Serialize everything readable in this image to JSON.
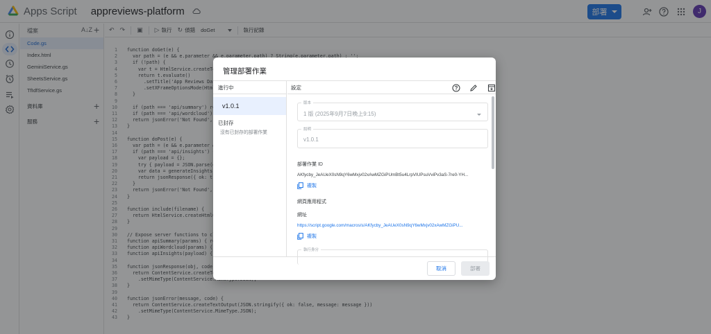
{
  "header": {
    "app_name": "Apps Script",
    "project_name": "appreviews-platform",
    "deploy_label": "部署",
    "avatar_letter": "J",
    "brand_color": "#1a73e8"
  },
  "files_panel": {
    "title": "檔案",
    "files": [
      "Code.gs",
      "Index.html",
      "GeminiService.gs",
      "SheetsService.gs",
      "TfIdfService.gs"
    ],
    "active_file": "Code.gs",
    "sections": [
      "資料庫",
      "服務"
    ]
  },
  "toolbar": {
    "run_label": "執行",
    "debug_label": "偵錯",
    "function_name": "doGet",
    "log_label": "執行記錄"
  },
  "code": {
    "lines": [
      {
        "n": "1",
        "t": "function doGet(e) {"
      },
      {
        "n": "2",
        "t": "  var path = (e && e.parameter && e.parameter.path) ? String(e.parameter.path) : '';"
      },
      {
        "n": "3",
        "t": "  if (!path) {"
      },
      {
        "n": "4",
        "t": "    var t = HtmlService.createTemplateFromFile('Index');"
      },
      {
        "n": "5",
        "t": "    return t.evaluate()"
      },
      {
        "n": "6",
        "t": "      .setTitle('App Reviews Dashboard')"
      },
      {
        "n": "7",
        "t": "      .setXFrameOptionsMode(HtmlService.XFrameOptionsMode.ALLOWALL);"
      },
      {
        "n": "8",
        "t": "  }"
      },
      {
        "n": "9",
        "t": ""
      },
      {
        "n": "10",
        "t": "  if (path === 'api/summary') return jsonResponse(apiSummary(e.parameter));"
      },
      {
        "n": "11",
        "t": "  if (path === 'api/wordcloud') return jsonResponse(apiWordcloud(e.parameter));"
      },
      {
        "n": "12",
        "t": "  return jsonError('Not Found', 404);"
      },
      {
        "n": "13",
        "t": "}"
      },
      {
        "n": "14",
        "t": ""
      },
      {
        "n": "15",
        "t": "function doPost(e) {"
      },
      {
        "n": "16",
        "t": "  var path = (e && e.parameter && e.parameter.path) ? String(e.parameter.path) : '';"
      },
      {
        "n": "17",
        "t": "  if (path === 'api/insights') {"
      },
      {
        "n": "18",
        "t": "    var payload = {};"
      },
      {
        "n": "19",
        "t": "    try { payload = JSON.parse(e.postData.contents || '{}'); } catch (err) {}"
      },
      {
        "n": "20",
        "t": "    var data = generateInsights(payload);"
      },
      {
        "n": "21",
        "t": "    return jsonResponse({ ok: true, data: data });"
      },
      {
        "n": "22",
        "t": "  }"
      },
      {
        "n": "23",
        "t": "  return jsonError('Not Found', 404);"
      },
      {
        "n": "24",
        "t": "}"
      },
      {
        "n": "25",
        "t": ""
      },
      {
        "n": "26",
        "t": "function include(filename) {"
      },
      {
        "n": "27",
        "t": "  return HtmlService.createHtmlOutputFromFile(filename).getContent();"
      },
      {
        "n": "28",
        "t": "}"
      },
      {
        "n": "29",
        "t": ""
      },
      {
        "n": "30",
        "t": "// Expose server functions to client"
      },
      {
        "n": "31",
        "t": "function apiSummary(params) { return getSummary(params); }"
      },
      {
        "n": "32",
        "t": "function apiWordcloud(params) { return getWordcloud(params); }"
      },
      {
        "n": "33",
        "t": "function apiInsights(payload) { return generateInsights(payload); }"
      },
      {
        "n": "34",
        "t": ""
      },
      {
        "n": "35",
        "t": "function jsonResponse(obj, code) {"
      },
      {
        "n": "36",
        "t": "  return ContentService.createTextOutput(JSON.stringify({ ok: true, data: obj && obj.ok === false ? null : obj }))"
      },
      {
        "n": "37",
        "t": "    .setMimeType(ContentService.MimeType.JSON);"
      },
      {
        "n": "38",
        "t": "}"
      },
      {
        "n": "39",
        "t": ""
      },
      {
        "n": "40",
        "t": "function jsonError(message, code) {"
      },
      {
        "n": "41",
        "t": "  return ContentService.createTextOutput(JSON.stringify({ ok: false, message: message }))"
      },
      {
        "n": "42",
        "t": "    .setMimeType(ContentService.MimeType.JSON);"
      },
      {
        "n": "43",
        "t": "}"
      }
    ]
  },
  "dialog": {
    "title": "管理部署作業",
    "active_header": "進行中",
    "version_label": "v1.0.1",
    "archived_header": "已封存",
    "archived_empty": "沒有已封存的部署作業",
    "settings_header": "設定",
    "version_field_label": "版本",
    "version_field_value": "1 版 (2025年9月7日晚上9:15)",
    "description_field_label": "說明",
    "description_field_value": "v1.0.1",
    "deployment_id_label": "部署作業 ID",
    "deployment_id": "AKfycby_JeAUeX0sN9qY6wMxjv02xAwMZGiPUmBt5u4LrpVIUPsuVviPv3aS-7re0-YH...",
    "copy_label": "複製",
    "webapp_label": "網頁應用程式",
    "url_label": "網址",
    "url": "https://script.google.com/macros/s/AKfycby_JeAUeX0sN9qY6wMxjv02xAwMZGiPU...",
    "copy_label_2": "複製",
    "execute_as_label": "執行身分",
    "cancel_label": "取消",
    "deploy_label": "部署"
  }
}
